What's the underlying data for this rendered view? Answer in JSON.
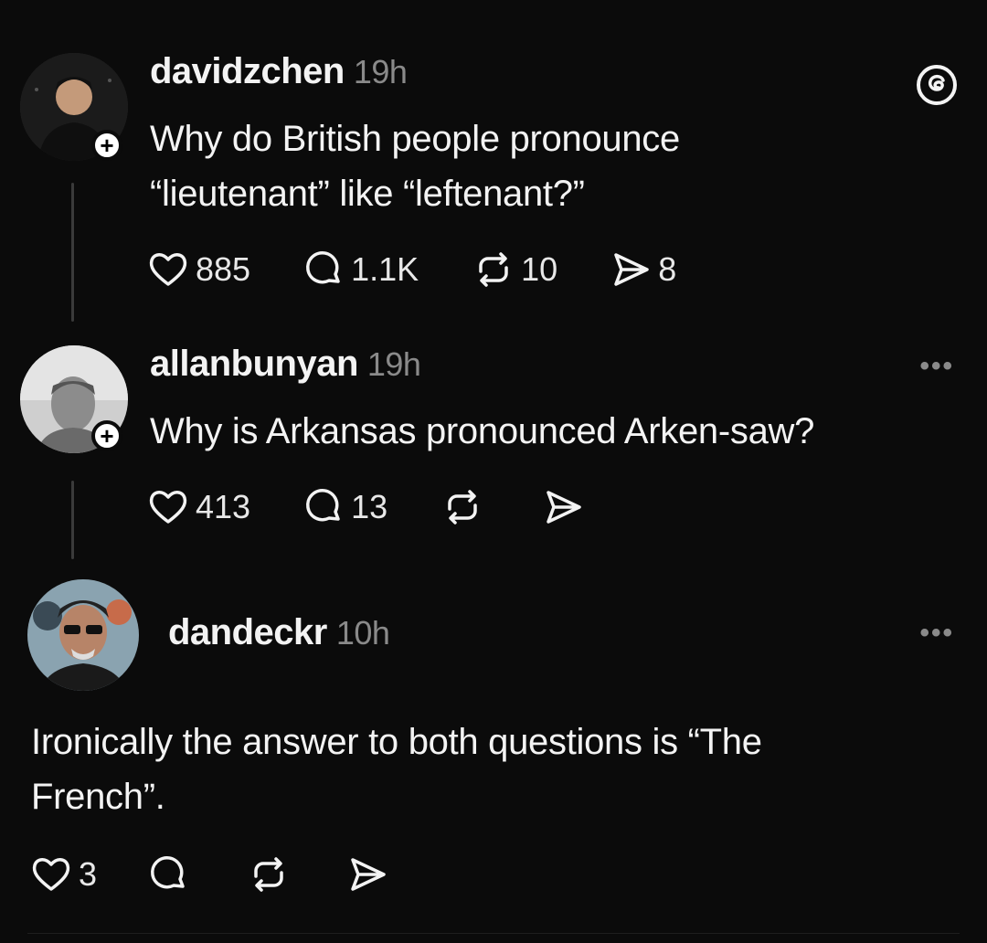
{
  "app": {
    "logo_icon": "threads-logo-icon"
  },
  "posts": [
    {
      "username": "davidzchen",
      "time": "19h",
      "text_lines": [
        "Why do British people pronounce",
        "“lieutenant” like “leftenant?”"
      ],
      "likes": "885",
      "comments": "1.1K",
      "reposts": "10",
      "shares": "8",
      "has_follow_plus": true
    },
    {
      "username": "allanbunyan",
      "time": "19h",
      "text_lines": [
        "Why is Arkansas pronounced Arken-saw?"
      ],
      "likes": "413",
      "comments": "13",
      "reposts": "",
      "shares": "",
      "more": "•••",
      "has_follow_plus": true
    },
    {
      "username": "dandeckr",
      "time": "10h",
      "text_lines": [
        "Ironically the answer to both questions is “The",
        "French”."
      ],
      "likes": "3",
      "comments": "",
      "reposts": "",
      "shares": "",
      "more": "•••",
      "has_follow_plus": false
    }
  ],
  "follow_plus": "+",
  "colors": {
    "background": "#0b0b0b",
    "text": "#f3f3f3",
    "muted": "#8a8a8a"
  }
}
